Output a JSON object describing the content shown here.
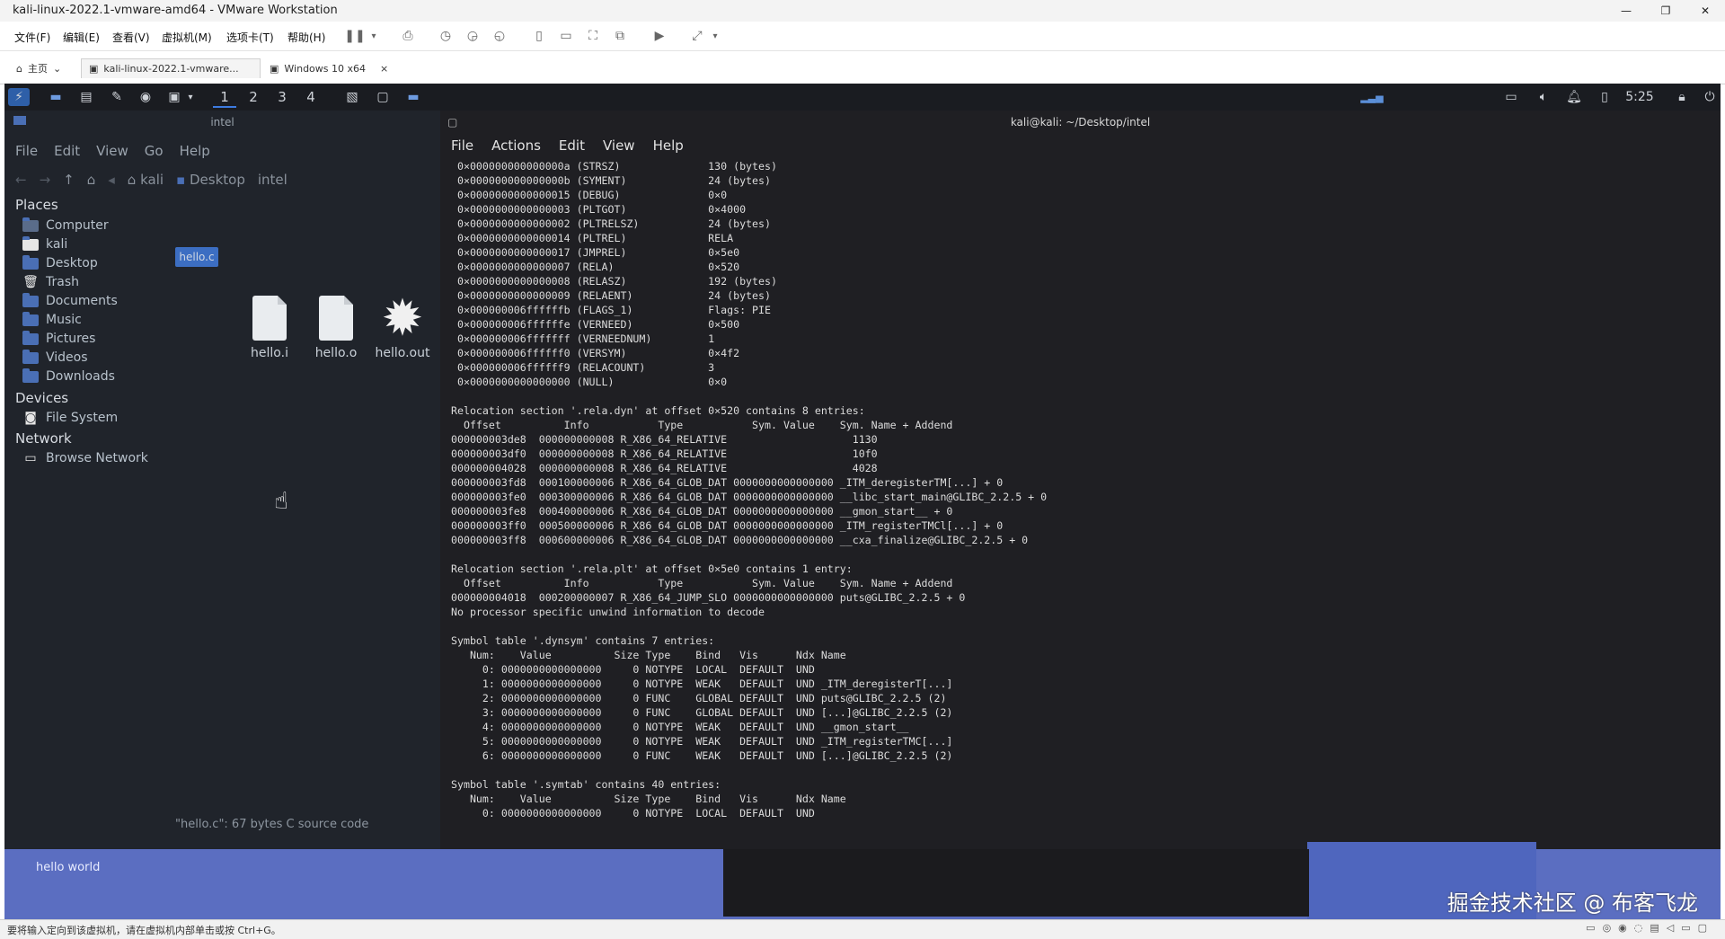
{
  "vmware": {
    "title": "kali-linux-2022.1-vmware-amd64 - VMware Workstation",
    "menu": [
      "文件(F)",
      "编辑(E)",
      "查看(V)",
      "虚拟机(M)",
      "选项卡(T)",
      "帮助(H)"
    ],
    "tabs": [
      {
        "label": "主页",
        "icon": "home-icon"
      },
      {
        "label": "kali-linux-2022.1-vmware...",
        "icon": "vm-icon",
        "active": true
      },
      {
        "label": "Windows 10 x64",
        "icon": "vm-icon"
      }
    ],
    "status_text": "要将输入定向到该虚拟机，请在虚拟机内部单击或按 Ctrl+G。"
  },
  "panel": {
    "workspaces": [
      "1",
      "2",
      "3",
      "4"
    ],
    "clock": "5:25"
  },
  "file_manager": {
    "title": "intel",
    "menu": [
      "File",
      "Edit",
      "View",
      "Go",
      "Help"
    ],
    "path": [
      "kali",
      "Desktop",
      "intel"
    ],
    "places_heading": "Places",
    "places": [
      "Computer",
      "kali",
      "Desktop",
      "Trash",
      "Documents",
      "Music",
      "Pictures",
      "Videos",
      "Downloads"
    ],
    "devices_heading": "Devices",
    "devices": [
      "File System"
    ],
    "network_heading": "Network",
    "network": [
      "Browse Network"
    ],
    "files": [
      {
        "name": "hello.c",
        "selected": true
      },
      {
        "name": "hello.i"
      },
      {
        "name": "hello.o"
      },
      {
        "name": "hello.out"
      }
    ],
    "status": "\"hello.c\": 67 bytes C source code"
  },
  "terminal": {
    "title": "kali@kali: ~/Desktop/intel",
    "menu": [
      "File",
      "Actions",
      "Edit",
      "View",
      "Help"
    ],
    "output": " 0×000000000000000a (STRSZ)              130 (bytes)\n 0×000000000000000b (SYMENT)             24 (bytes)\n 0×0000000000000015 (DEBUG)              0×0\n 0×0000000000000003 (PLTGOT)             0×4000\n 0×0000000000000002 (PLTRELSZ)           24 (bytes)\n 0×0000000000000014 (PLTREL)             RELA\n 0×0000000000000017 (JMPREL)             0×5e0\n 0×0000000000000007 (RELA)               0×520\n 0×0000000000000008 (RELASZ)             192 (bytes)\n 0×0000000000000009 (RELAENT)            24 (bytes)\n 0×000000006ffffffb (FLAGS_1)            Flags: PIE\n 0×000000006ffffffe (VERNEED)            0×500\n 0×000000006fffffff (VERNEEDNUM)         1\n 0×000000006ffffff0 (VERSYM)             0×4f2\n 0×000000006ffffff9 (RELACOUNT)          3\n 0×0000000000000000 (NULL)               0×0\n\nRelocation section '.rela.dyn' at offset 0×520 contains 8 entries:\n  Offset          Info           Type           Sym. Value    Sym. Name + Addend\n000000003de8  000000000008 R_X86_64_RELATIVE                    1130\n000000003df0  000000000008 R_X86_64_RELATIVE                    10f0\n000000004028  000000000008 R_X86_64_RELATIVE                    4028\n000000003fd8  000100000006 R_X86_64_GLOB_DAT 0000000000000000 _ITM_deregisterTM[...] + 0\n000000003fe0  000300000006 R_X86_64_GLOB_DAT 0000000000000000 __libc_start_main@GLIBC_2.2.5 + 0\n000000003fe8  000400000006 R_X86_64_GLOB_DAT 0000000000000000 __gmon_start__ + 0\n000000003ff0  000500000006 R_X86_64_GLOB_DAT 0000000000000000 _ITM_registerTMCl[...] + 0\n000000003ff8  000600000006 R_X86_64_GLOB_DAT 0000000000000000 __cxa_finalize@GLIBC_2.2.5 + 0\n\nRelocation section '.rela.plt' at offset 0×5e0 contains 1 entry:\n  Offset          Info           Type           Sym. Value    Sym. Name + Addend\n000000004018  000200000007 R_X86_64_JUMP_SLO 0000000000000000 puts@GLIBC_2.2.5 + 0\nNo processor specific unwind information to decode\n\nSymbol table '.dynsym' contains 7 entries:\n   Num:    Value          Size Type    Bind   Vis      Ndx Name\n     0: 0000000000000000     0 NOTYPE  LOCAL  DEFAULT  UND\n     1: 0000000000000000     0 NOTYPE  WEAK   DEFAULT  UND _ITM_deregisterT[...]\n     2: 0000000000000000     0 FUNC    GLOBAL DEFAULT  UND puts@GLIBC_2.2.5 (2)\n     3: 0000000000000000     0 FUNC    GLOBAL DEFAULT  UND [...]@GLIBC_2.2.5 (2)\n     4: 0000000000000000     0 NOTYPE  WEAK   DEFAULT  UND __gmon_start__\n     5: 0000000000000000     0 NOTYPE  WEAK   DEFAULT  UND _ITM_registerTMC[...]\n     6: 0000000000000000     0 FUNC    WEAK   DEFAULT  UND [...]@GLIBC_2.2.5 (2)\n\nSymbol table '.symtab' contains 40 entries:\n   Num:    Value          Size Type    Bind   Vis      Ndx Name\n     0: 0000000000000000     0 NOTYPE  LOCAL  DEFAULT  UND"
  },
  "desktop": {
    "label": "hello world",
    "watermark": "掘金技术社区 @ 布客飞龙"
  },
  "colors": {
    "panel_bg": "#1a1c21",
    "fm_bg": "#20242b",
    "terminal_bg": "#1f1f23",
    "accent": "#3c6ec2",
    "desktop_blue": "#5b6ec1"
  }
}
